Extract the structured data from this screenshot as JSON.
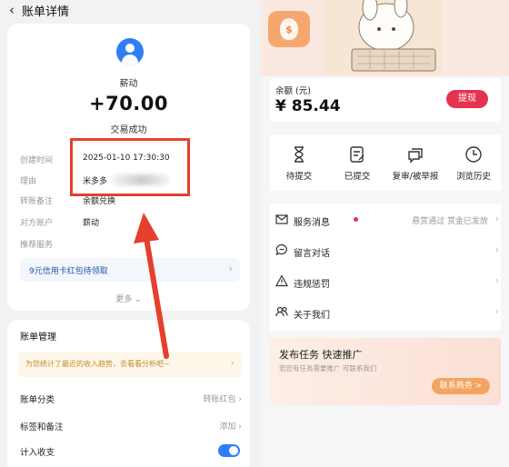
{
  "left": {
    "header": {
      "back_icon": "chevron-left-icon",
      "title": "账单详情"
    },
    "payee_name": "薪动",
    "amount": "+70.00",
    "status": "交易成功",
    "details": [
      {
        "label": "创建时间",
        "value": "2025-01-10 17:30:30"
      },
      {
        "label": "理由",
        "value": "米多多"
      },
      {
        "label": "转账备注",
        "value": "余额兑换"
      },
      {
        "label": "对方账户",
        "value": "薪动"
      },
      {
        "label": "推荐服务",
        "value": ""
      }
    ],
    "promo_text": "9元信用卡红包待领取",
    "more_label": "更多",
    "bill_management": {
      "title": "账单管理",
      "trend_tip": "为您统计了最近的收入趋势，去看看分析吧~",
      "rows": [
        {
          "label": "账单分类",
          "value": "转账红包"
        },
        {
          "label": "标签和备注",
          "value": "添加"
        },
        {
          "label": "计入收支",
          "toggle_on": true
        }
      ]
    },
    "accent_color": "#2f7ff3",
    "highlight_color": "#e4402b"
  },
  "right": {
    "balance": {
      "label": "余额 (元)",
      "value": "¥ 85.44",
      "withdraw_label": "提现"
    },
    "shortcuts": [
      {
        "icon": "hourglass-icon",
        "label": "待提交"
      },
      {
        "icon": "document-edit-icon",
        "label": "已提交"
      },
      {
        "icon": "chat-bubbles-icon",
        "label": "复审/被举报"
      },
      {
        "icon": "clock-icon",
        "label": "浏览历史"
      }
    ],
    "menu": [
      {
        "icon": "mail-icon",
        "label": "服务消息",
        "badge": true,
        "right_text": "悬赏通过 赏金已发放"
      },
      {
        "icon": "chat-icon",
        "label": "留言对话",
        "right_text": ""
      },
      {
        "icon": "warning-icon",
        "label": "违规惩罚",
        "right_text": ""
      },
      {
        "icon": "users-icon",
        "label": "关于我们",
        "right_text": ""
      }
    ],
    "publish": {
      "title": "发布任务 快速推广",
      "subtitle": "若您有任务需要推广 可联系我们",
      "button_label": "联系商务 >"
    },
    "brand_color": "#e4334e"
  }
}
